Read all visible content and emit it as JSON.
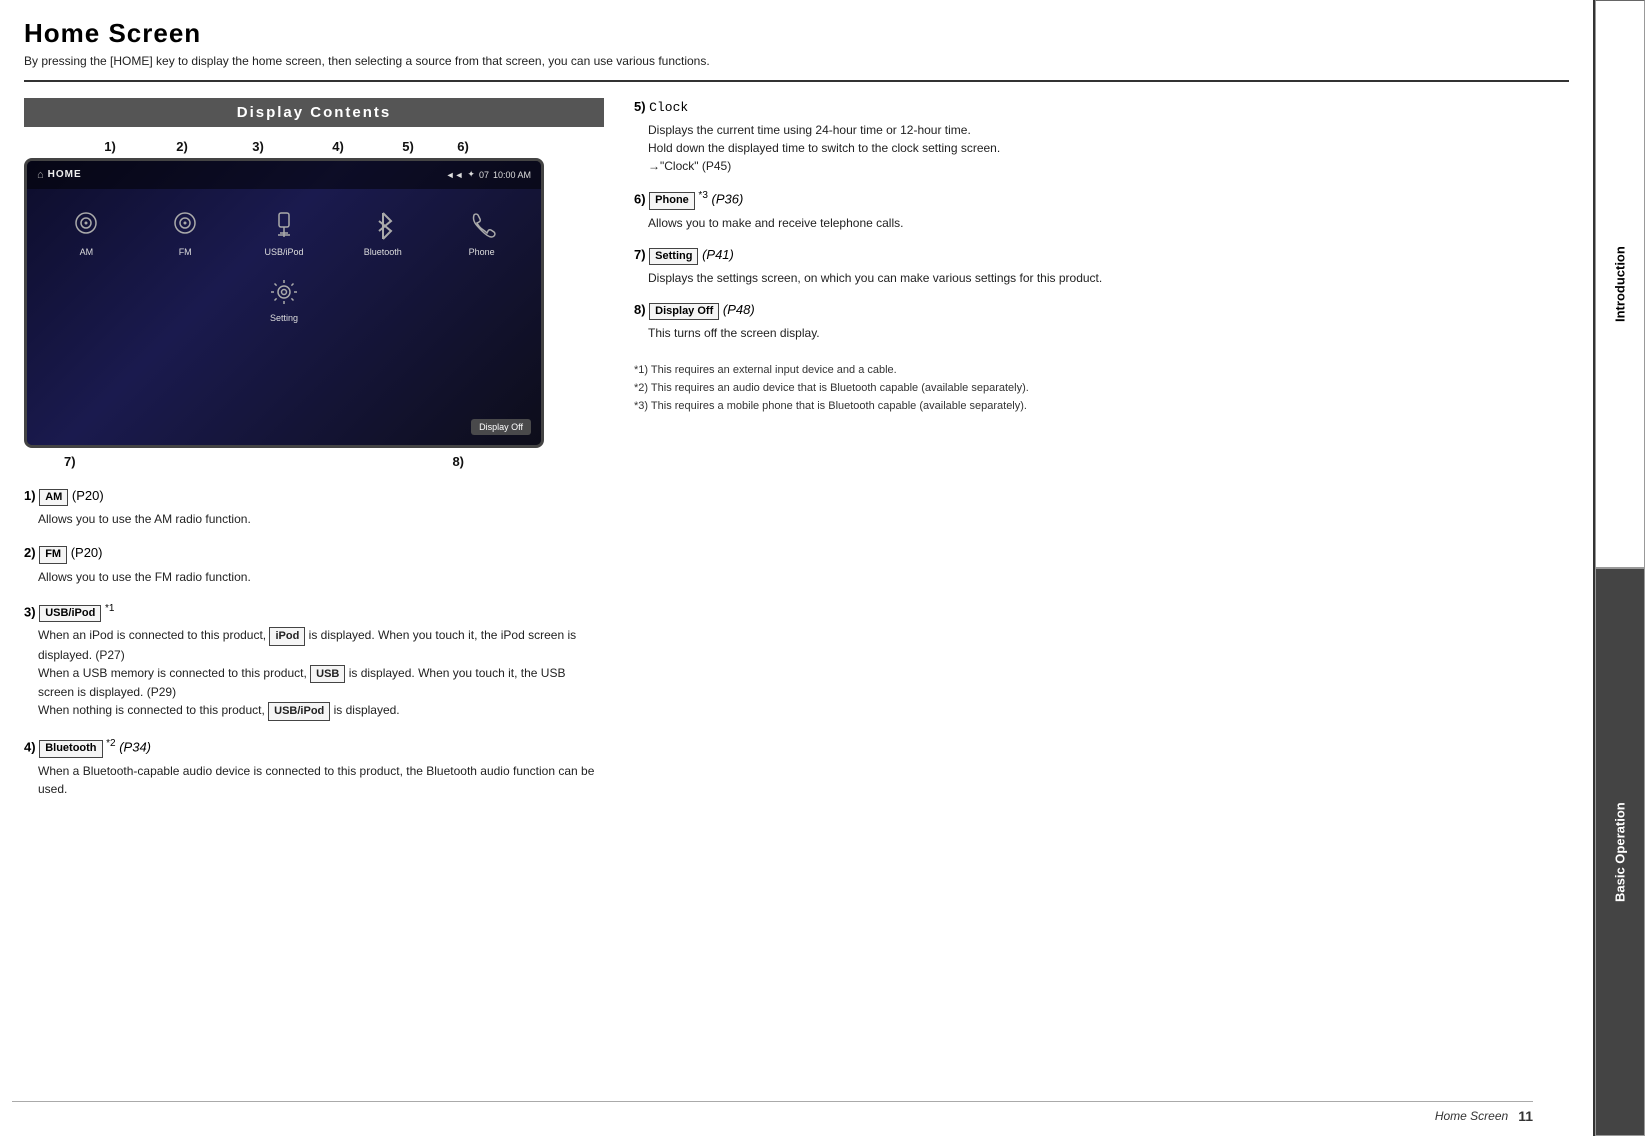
{
  "page": {
    "title": "Home Screen",
    "subtitle": "By pressing the [HOME] key to display the home screen, then selecting a source from that screen, you can use various functions.",
    "section_title": "Display Contents"
  },
  "screen": {
    "header_label": "HOME",
    "status_bar": "◄ ◄  ✦ 07   10:00 AM",
    "icons": [
      {
        "id": "am",
        "label": "AM",
        "symbol": "≋"
      },
      {
        "id": "fm",
        "label": "FM",
        "symbol": "≋"
      },
      {
        "id": "usb_ipod",
        "label": "USB/iPod",
        "symbol": "🎵"
      },
      {
        "id": "bluetooth",
        "label": "Bluetooth",
        "symbol": "✦"
      },
      {
        "id": "phone",
        "label": "Phone",
        "symbol": "📞"
      }
    ],
    "bottom_icons": [
      {
        "id": "setting",
        "label": "Setting",
        "symbol": "⚙"
      }
    ],
    "display_off_label": "Display Off"
  },
  "number_labels_top": [
    "1)",
    "2)",
    "3)",
    "4)",
    "5)",
    "6)"
  ],
  "number_labels_bottom": [
    "7)",
    "8)"
  ],
  "left_items": [
    {
      "num": "1)",
      "badge": "AM",
      "ref": "(P20)",
      "text": "Allows you to use the AM radio function."
    },
    {
      "num": "2)",
      "badge": "FM",
      "ref": "(P20)",
      "text": "Allows you to use the FM radio function."
    },
    {
      "num": "3)",
      "badge": "USB/iPod",
      "superscript": "*1",
      "ref": "",
      "text_parts": [
        "When an iPod is connected to this product,",
        "iPod",
        "is displayed. When you touch it, the iPod screen is displayed. (P27)",
        "When a USB memory is connected to this product,",
        "USB",
        "is displayed. When you touch it, the USB screen is displayed. (P29)",
        "When nothing is connected to this product,",
        "USB/iPod",
        "is displayed."
      ]
    },
    {
      "num": "4)",
      "badge": "Bluetooth",
      "superscript": "*2",
      "ref": "(P34)",
      "text": "When a Bluetooth-capable audio device is connected to this product, the Bluetooth audio function can be used."
    }
  ],
  "right_items": [
    {
      "num": "5)",
      "label": "Clock",
      "text_lines": [
        "Displays the current time using 24-hour time or 12-hour time.",
        "Hold down the displayed time to switch to the clock setting screen.",
        "→\"Clock\" (P45)"
      ]
    },
    {
      "num": "6)",
      "badge": "Phone",
      "superscript": "*3",
      "ref": "(P36)",
      "text": "Allows you to make and receive telephone calls."
    },
    {
      "num": "7)",
      "badge": "Setting",
      "ref": "(P41)",
      "text": "Displays the settings screen, on which you can make various settings for this product."
    },
    {
      "num": "8)",
      "badge": "Display Off",
      "ref": "(P48)",
      "text": "This turns off the screen display."
    }
  ],
  "footnotes": [
    "*1) This requires an external input device and a cable.",
    "*2) This requires an audio device that is Bluetooth capable (available separately).",
    "*3) This requires a mobile phone that is Bluetooth capable (available separately)."
  ],
  "sidebar": {
    "tabs": [
      {
        "id": "introduction",
        "label": "Introduction",
        "active": false
      },
      {
        "id": "basic-operation",
        "label": "Basic Operation",
        "active": true
      }
    ]
  },
  "footer": {
    "label": "Home Screen",
    "page_number": "11"
  }
}
